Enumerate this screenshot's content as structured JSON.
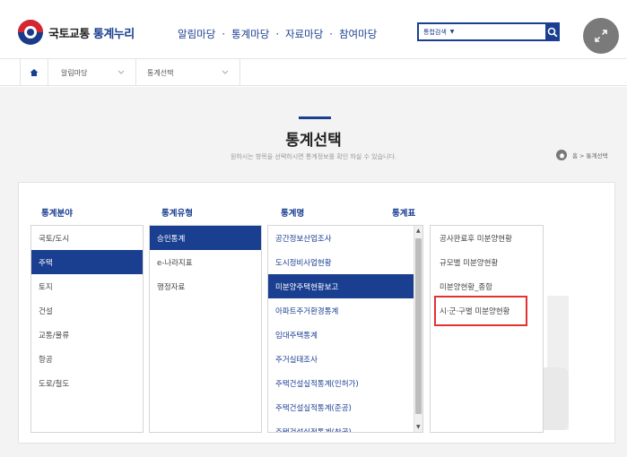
{
  "header": {
    "logo_main": "국토교통",
    "logo_accent": "통계누리",
    "nav": [
      "알림마당",
      "통계마당",
      "자료마당",
      "참여마당"
    ],
    "nav_separator": "·",
    "search": {
      "select_label": "통합검색",
      "value": "",
      "placeholder": ""
    }
  },
  "breadcrumb": {
    "level1": "알림마당",
    "level2": "통계선택"
  },
  "page": {
    "title": "통계선택",
    "description": "원하시는 항목을 선택하시면 통계정보를 확인 하실 수 있습니다.",
    "location": "홈 > 통계선택"
  },
  "columns": {
    "field": {
      "header": "통계분야",
      "items": [
        "국토/도시",
        "주택",
        "토지",
        "건설",
        "교통/물류",
        "항공",
        "도로/철도"
      ],
      "selected": 1
    },
    "type": {
      "header": "통계유형",
      "items": [
        "승인통계",
        "e-나라지표",
        "행정자료"
      ],
      "selected": 0
    },
    "name": {
      "header": "통계명",
      "items": [
        "공간정보산업조사",
        "도시정비사업현황",
        "미분양주택현황보고",
        "아파트주거환경통계",
        "임대주택통계",
        "주거실태조사",
        "주택건설실적통계(인허가)",
        "주택건설실적통계(준공)",
        "주택건설실적통계(착공)"
      ],
      "selected": 2
    },
    "table": {
      "header": "통계표",
      "items": [
        "공사완료후 미분양현황",
        "규모별 미분양현황",
        "미분양현황_종합",
        "시·군·구별 미분양현황"
      ],
      "highlighted": 3
    }
  },
  "colors": {
    "brand": "#1a3f91",
    "highlight_box": "#e23232",
    "background": "#f3f3f3"
  },
  "icons": {
    "home": "home-icon",
    "search": "search-icon",
    "expand": "expand-icon",
    "chevron": "chevron-down-icon"
  }
}
